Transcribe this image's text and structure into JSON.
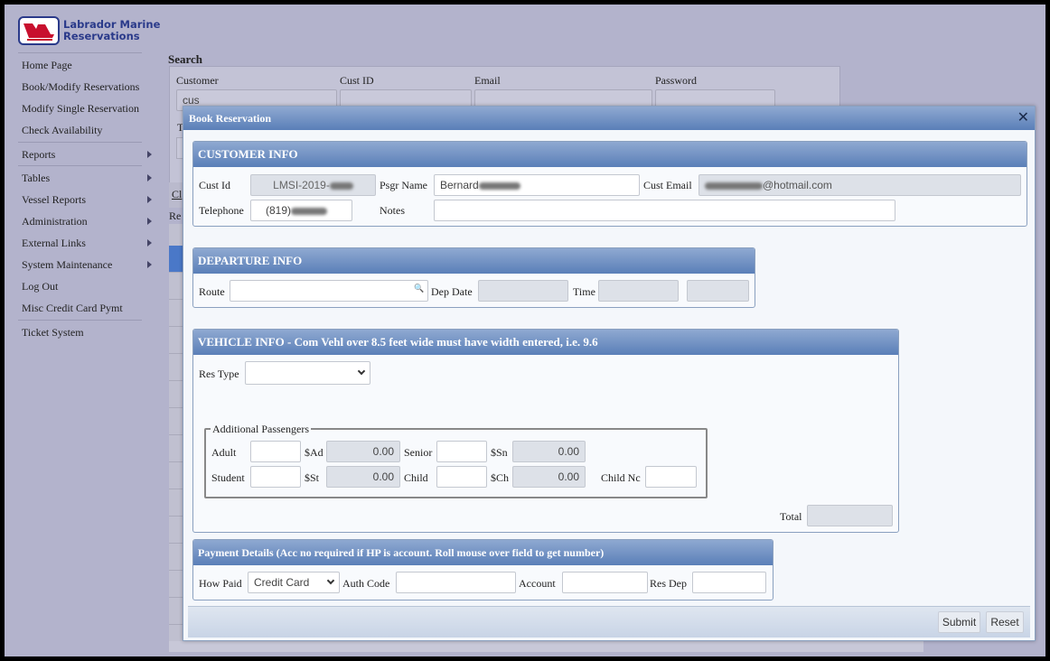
{
  "app": {
    "logo_line1": "Labrador Marine",
    "logo_line2": "Reservations",
    "brand_color": "#c8102e",
    "bg_color": "#b3b3cc",
    "header_color": "#5a7fb8"
  },
  "sidebar": {
    "items": [
      {
        "label": "Home Page"
      },
      {
        "label": "Book/Modify Reservations"
      },
      {
        "label": "Modify Single Reservation"
      },
      {
        "label": "Check Availability"
      },
      {
        "label": "Reports",
        "submenu": true
      },
      {
        "label": "Tables",
        "submenu": true
      },
      {
        "label": "Vessel Reports",
        "submenu": true
      },
      {
        "label": "Administration",
        "submenu": true
      },
      {
        "label": "External Links",
        "submenu": true
      },
      {
        "label": "System Maintenance",
        "submenu": true
      },
      {
        "label": "Log Out"
      },
      {
        "label": "Misc Credit Card Pymt"
      },
      {
        "label": "Ticket System"
      }
    ]
  },
  "search": {
    "title": "Search",
    "customer_label": "Customer",
    "customer_value": "cus",
    "custid_label": "Cust ID",
    "email_label": "Email",
    "password_label": "Password",
    "partial_label_t": "T",
    "partial_link": "Cl",
    "partial_label_re": "Re"
  },
  "modal": {
    "title": "Book Reservation",
    "close_icon": "close-icon",
    "customer": {
      "header": "CUSTOMER INFO",
      "cust_id_label": "Cust Id",
      "cust_id_value": "LMSI-2019-",
      "psgr_name_label": "Psgr Name",
      "psgr_name_value": "Bernard",
      "cust_email_label": "Cust Email",
      "cust_email_value": "@hotmail.com",
      "telephone_label": "Telephone",
      "telephone_value": "(819)",
      "notes_label": "Notes",
      "notes_value": ""
    },
    "departure": {
      "header": "DEPARTURE INFO",
      "route_label": "Route",
      "route_value": "",
      "dep_date_label": "Dep Date",
      "time_label": "Time"
    },
    "vehicle": {
      "header": "VEHICLE INFO - Com Vehl over 8.5 feet wide must have width entered, i.e. 9.6",
      "res_type_label": "Res Type",
      "res_type_value": "",
      "passengers_legend": "Additional Passengers",
      "adult_label": "Adult",
      "sad_label": "$Ad",
      "sad_value": "0.00",
      "senior_label": "Senior",
      "ssn_label": "$Sn",
      "ssn_value": "0.00",
      "student_label": "Student",
      "sst_label": "$St",
      "sst_value": "0.00",
      "child_label": "Child",
      "sch_label": "$Ch",
      "sch_value": "0.00",
      "child_nc_label": "Child Nc",
      "total_label": "Total",
      "total_value": ""
    },
    "payment": {
      "header": "Payment Details (Acc no required if HP is account. Roll mouse over field to get number)",
      "how_paid_label": "How Paid",
      "how_paid_value": "Credit Card",
      "auth_code_label": "Auth Code",
      "account_label": "Account",
      "res_dep_label": "Res Dep"
    },
    "footer": {
      "submit_label": "Submit",
      "reset_label": "Reset"
    }
  }
}
